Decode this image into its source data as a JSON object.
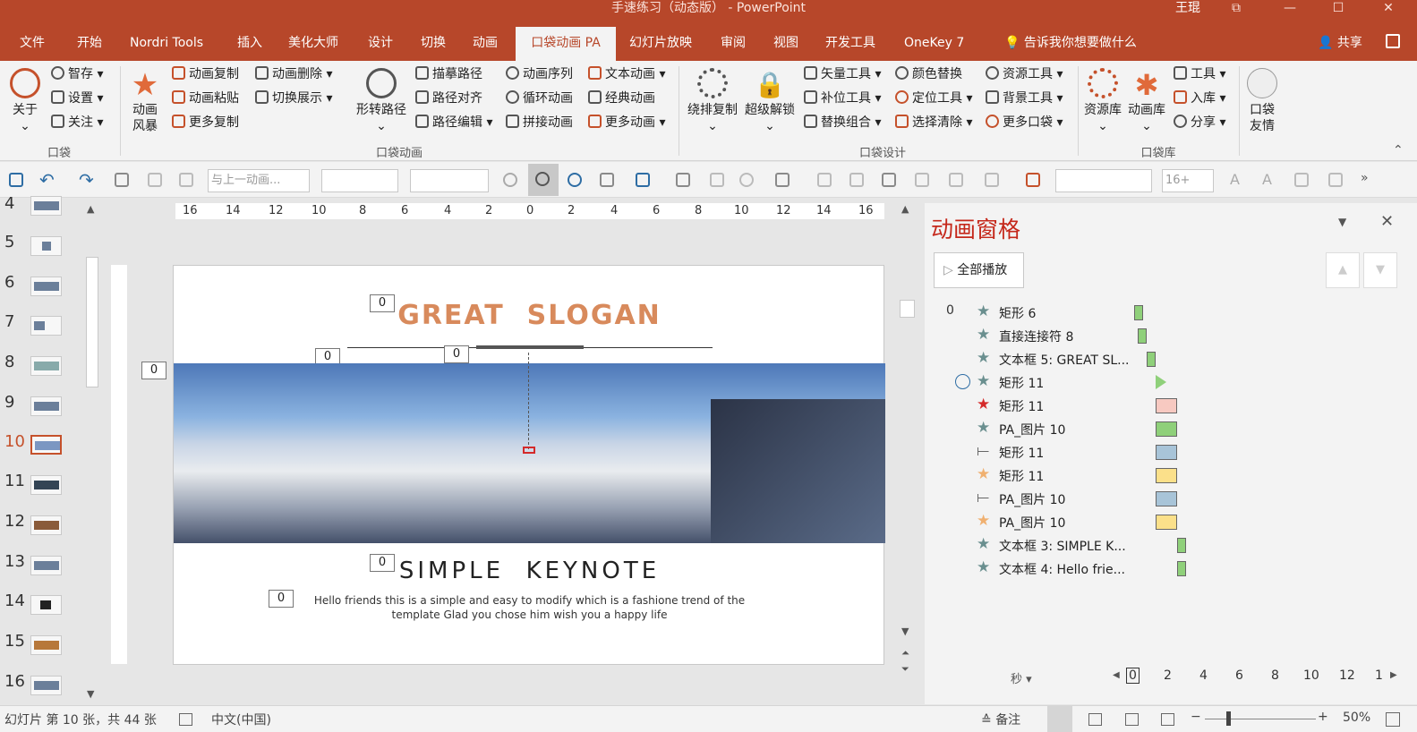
{
  "window": {
    "title": "手速练习（动态版） - PowerPoint",
    "user": "王琨",
    "controls": [
      "⧉",
      "—",
      "☐",
      "✕"
    ]
  },
  "menu": {
    "tabs": [
      "文件",
      "开始",
      "Nordri Tools",
      "插入",
      "美化大师",
      "设计",
      "切换",
      "动画",
      "口袋动画 PA",
      "幻灯片放映",
      "审阅",
      "视图",
      "开发工具",
      "OneKey 7"
    ],
    "tell_me": "告诉我你想要做什么",
    "share": "共享"
  },
  "ribbon": {
    "pocket": {
      "about": "关于",
      "items": [
        "智存",
        "设置",
        "关注"
      ],
      "group": "口袋"
    },
    "anim": {
      "storm": "动画风暴",
      "copy": "动画复制",
      "paste": "动画粘贴",
      "more_copy": "更多复制",
      "delete": "动画删除",
      "switch": "切换展示",
      "shape_path": "形转路径",
      "trace": "描摹路径",
      "align": "路径对齐",
      "edit": "路径编辑",
      "sequence": "动画序列",
      "loop": "循环动画",
      "splice": "拼接动画",
      "text": "文本动画",
      "classic": "经典动画",
      "more": "更多动画",
      "group": "口袋动画"
    },
    "design": {
      "orbit": "绕排复制",
      "unlock": "超级解锁",
      "vector": "矢量工具",
      "fill": "补位工具",
      "combo": "替换组合",
      "color": "颜色替换",
      "locate": "定位工具",
      "clear": "选择清除",
      "resource": "资源工具",
      "bg": "背景工具",
      "more": "更多口袋",
      "group": "口袋设计"
    },
    "lib": {
      "res": "资源库",
      "anim": "动画库",
      "tools": "工具",
      "import": "入库",
      "share": "分享",
      "group": "口袋库",
      "friend": "口袋友情"
    }
  },
  "qat": {
    "prev_anim": "与上一动画...",
    "font_size": "16+"
  },
  "slides": {
    "current": 10,
    "numbers": [
      4,
      5,
      6,
      7,
      8,
      9,
      10,
      11,
      12,
      13,
      14,
      15,
      16
    ]
  },
  "ruler": {
    "labels": [
      "16",
      "14",
      "12",
      "10",
      "8",
      "6",
      "4",
      "2",
      "0",
      "2",
      "4",
      "6",
      "8",
      "10",
      "12",
      "14",
      "16"
    ]
  },
  "slide": {
    "title": "GREAT  SLOGAN",
    "subtitle": "SIMPLE  KEYNOTE",
    "body_line1": "Hello friends this is a simple and easy to modify which is a fashione trend of the",
    "body_line2": "template Glad you chose him wish you a happy life",
    "tag": "0"
  },
  "pane": {
    "title": "动画窗格",
    "play_all": "全部播放",
    "first_index": "0",
    "seconds": "秒",
    "items": [
      {
        "label": "矩形 6",
        "mark": "★",
        "mark_color": "#6a8f8f",
        "bar_color": "#8fd07a"
      },
      {
        "label": "直接连接符 8",
        "mark": "★",
        "mark_color": "#6a8f8f",
        "bar_color": "#8fd07a"
      },
      {
        "label": "文本框 5: GREAT SL...",
        "mark": "★",
        "mark_color": "#6a8f8f",
        "bar_color": "#8fd07a"
      },
      {
        "label": "矩形 11",
        "mark": "★",
        "mark_color": "#6a8f8f",
        "bar_color": "#8fd07a"
      },
      {
        "label": "矩形 11",
        "mark": "★",
        "mark_color": "#d42a2a",
        "bar_color": "#f7c9c1"
      },
      {
        "label": "PA_图片 10",
        "mark": "★",
        "mark_color": "#6a8f8f",
        "bar_color": "#8fd07a"
      },
      {
        "label": "矩形 11",
        "mark": "⟝",
        "mark_color": "#666",
        "bar_color": "#a8c4d8"
      },
      {
        "label": "矩形 11",
        "mark": "★",
        "mark_color": "#f0b070",
        "bar_color": "#fbe08a"
      },
      {
        "label": "PA_图片 10",
        "mark": "⟝",
        "mark_color": "#666",
        "bar_color": "#a8c4d8"
      },
      {
        "label": "PA_图片 10",
        "mark": "★",
        "mark_color": "#f0b070",
        "bar_color": "#fbe08a"
      },
      {
        "label": "文本框 3: SIMPLE K...",
        "mark": "★",
        "mark_color": "#6a8f8f",
        "bar_color": "#8fd07a"
      },
      {
        "label": "文本框 4: Hello frie...",
        "mark": "★",
        "mark_color": "#6a8f8f",
        "bar_color": "#8fd07a"
      }
    ],
    "timeline": [
      "0",
      "2",
      "4",
      "6",
      "8",
      "10",
      "12",
      "1"
    ]
  },
  "status": {
    "slide_info": "幻灯片 第 10 张，共 44 张",
    "language": "中文(中国)",
    "notes": "备注",
    "zoom": "50%"
  },
  "colors": {
    "accent": "#b7472a",
    "title_orange": "#d88a5c"
  }
}
